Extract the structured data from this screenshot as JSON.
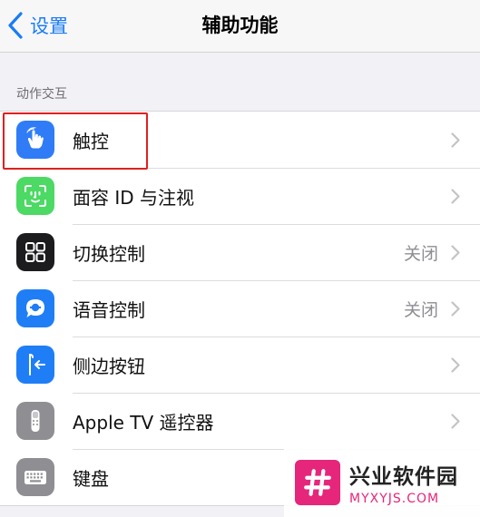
{
  "navbar": {
    "back_label": "设置",
    "title": "辅助功能"
  },
  "section": {
    "header": "动作交互",
    "rows": [
      {
        "label": "触控",
        "value": "",
        "icon": "hand-touch-icon",
        "color": "#2f7cf6"
      },
      {
        "label": "面容 ID 与注视",
        "value": "",
        "icon": "face-id-icon",
        "color": "#4cd964"
      },
      {
        "label": "切换控制",
        "value": "关闭",
        "icon": "switch-control-icon",
        "color": "#1c1c1e"
      },
      {
        "label": "语音控制",
        "value": "关闭",
        "icon": "voice-control-icon",
        "color": "#1f7ef5"
      },
      {
        "label": "侧边按钮",
        "value": "",
        "icon": "side-button-icon",
        "color": "#1f7ef5"
      },
      {
        "label": "Apple TV 遥控器",
        "value": "",
        "icon": "remote-icon",
        "color": "#8e8e93"
      },
      {
        "label": "键盘",
        "value": "",
        "icon": "keyboard-icon",
        "color": "#8e8e93"
      }
    ]
  },
  "watermark": {
    "name": "兴业软件园",
    "url": "MYXYJS.COM"
  },
  "colors": {
    "accent": "#1a7cf5",
    "highlight": "#e02020",
    "watermark": "#e6267a"
  }
}
